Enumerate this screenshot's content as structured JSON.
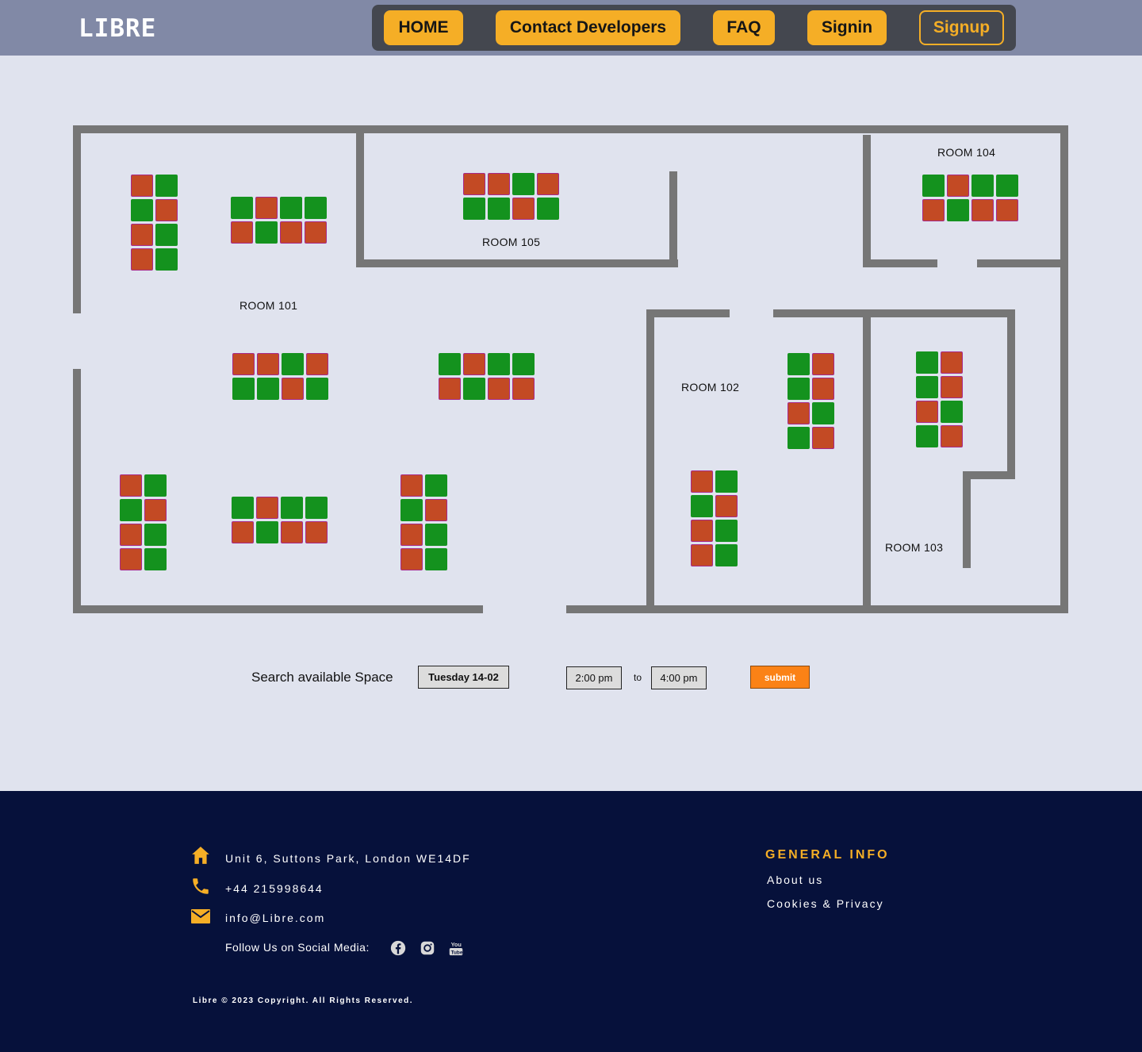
{
  "header": {
    "logo": "LIBRE",
    "nav": [
      {
        "label": "HOME"
      },
      {
        "label": "Contact Developers"
      },
      {
        "label": "FAQ"
      },
      {
        "label": "Signin"
      },
      {
        "label": "Signup"
      }
    ]
  },
  "floorplan": {
    "rooms": [
      {
        "label": "ROOM 101"
      },
      {
        "label": "ROOM 102"
      },
      {
        "label": "ROOM 103"
      },
      {
        "label": "ROOM 104"
      },
      {
        "label": "ROOM 105"
      }
    ],
    "seat_colors": {
      "available": "#14921e",
      "booked": "#c34a24"
    },
    "seat_groups": [
      {
        "room": "ROOM 101",
        "rows": [
          [
            "booked",
            "available"
          ],
          [
            "available",
            "booked"
          ],
          [
            "booked",
            "available"
          ],
          [
            "booked",
            "available"
          ]
        ]
      },
      {
        "room": "ROOM 101",
        "rows": [
          [
            "available",
            "booked",
            "available",
            "available"
          ],
          [
            "booked",
            "available",
            "booked",
            "booked"
          ]
        ]
      },
      {
        "room": "ROOM 105",
        "rows": [
          [
            "booked",
            "booked",
            "available",
            "booked"
          ],
          [
            "available",
            "available",
            "booked",
            "available"
          ]
        ]
      },
      {
        "room": "ROOM 104",
        "rows": [
          [
            "available",
            "booked",
            "available",
            "available"
          ],
          [
            "booked",
            "available",
            "booked",
            "booked"
          ]
        ]
      },
      {
        "room": "ROOM 101",
        "rows": [
          [
            "booked",
            "booked",
            "available",
            "booked"
          ],
          [
            "available",
            "available",
            "booked",
            "available"
          ]
        ]
      },
      {
        "room": "ROOM 101",
        "rows": [
          [
            "available",
            "booked",
            "available",
            "available"
          ],
          [
            "booked",
            "available",
            "booked",
            "booked"
          ]
        ]
      },
      {
        "room": "ROOM 102",
        "rows": [
          [
            "available",
            "booked"
          ],
          [
            "available",
            "booked"
          ],
          [
            "booked",
            "available"
          ],
          [
            "available",
            "booked"
          ]
        ]
      },
      {
        "room": "ROOM 103",
        "rows": [
          [
            "available",
            "booked"
          ],
          [
            "available",
            "booked"
          ],
          [
            "booked",
            "available"
          ],
          [
            "available",
            "booked"
          ]
        ]
      },
      {
        "room": "ROOM 101",
        "rows": [
          [
            "booked",
            "available"
          ],
          [
            "available",
            "booked"
          ],
          [
            "booked",
            "available"
          ],
          [
            "booked",
            "available"
          ]
        ]
      },
      {
        "room": "ROOM 101",
        "rows": [
          [
            "available",
            "booked",
            "available",
            "available"
          ],
          [
            "booked",
            "available",
            "booked",
            "booked"
          ]
        ]
      },
      {
        "room": "ROOM 101",
        "rows": [
          [
            "booked",
            "available"
          ],
          [
            "available",
            "booked"
          ],
          [
            "booked",
            "available"
          ],
          [
            "booked",
            "available"
          ]
        ]
      },
      {
        "room": "ROOM 102",
        "rows": [
          [
            "booked",
            "available"
          ],
          [
            "available",
            "booked"
          ],
          [
            "booked",
            "available"
          ],
          [
            "booked",
            "available"
          ]
        ]
      }
    ]
  },
  "search": {
    "label": "Search  available Space",
    "date": "Tuesday 14-02",
    "start_time": "2:00 pm",
    "to_label": "to",
    "end_time": "4:00 pm",
    "submit_label": "submit"
  },
  "footer": {
    "address": "Unit 6, Suttons Park, London WE14DF",
    "phone": "+44 215998644",
    "email": "info@Libre.com",
    "follow_label": "Follow Us on Social Media:",
    "social": [
      "facebook-icon",
      "instagram-icon",
      "youtube-icon"
    ],
    "general_info_title": "GENERAL INFO",
    "links": [
      "About us",
      "Cookies & Privacy"
    ],
    "copyright": "Libre © 2023 Copyright. All Rights Reserved.",
    "accent_color": "#f5ae26"
  }
}
